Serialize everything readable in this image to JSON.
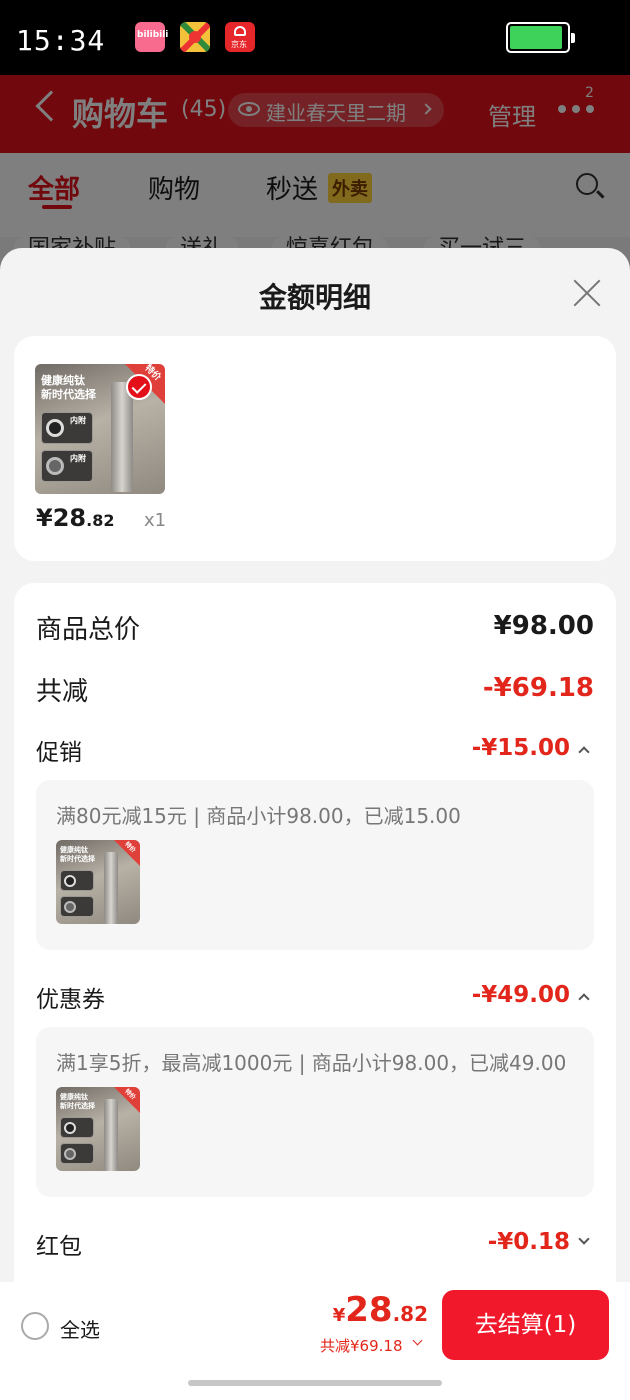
{
  "status_bar": {
    "time": "15:34",
    "app_icons": [
      "bilibili-icon",
      "map-icon",
      "jd-icon"
    ],
    "bili_text": "bilibili",
    "jd_text": "京东"
  },
  "cart_header": {
    "title": "购物车",
    "count": "(45)",
    "address": "建业春天里二期",
    "manage": "管理",
    "badge": "2"
  },
  "tabs": [
    {
      "label": "全部",
      "active": true
    },
    {
      "label": "购物",
      "active": false
    },
    {
      "label": "秒送",
      "active": false
    }
  ],
  "takeout_tag": "外卖",
  "filter_chips": [
    "国家补贴",
    "送礼",
    "惊喜红包",
    "买一试三"
  ],
  "sheet": {
    "title": "金额明细",
    "product": {
      "thumb_text": [
        "健康纯钛",
        "新时代选择"
      ],
      "badge_text": "特价",
      "inner_labels": [
        "内附",
        "内附"
      ],
      "price_int": "¥28",
      "price_dec": ".82",
      "qty": "x1"
    },
    "summary": {
      "total_label": "商品总价",
      "total_value": "¥98.00",
      "discount_label": "共减",
      "discount_value": "-¥69.18"
    },
    "promo": {
      "label": "促销",
      "value": "-¥15.00",
      "detail": "满80元减15元 | 商品小计98.00，已减15.00"
    },
    "coupon": {
      "label": "优惠券",
      "value": "-¥49.00",
      "detail": "满1享5折，最高减1000元 | 商品小计98.00，已减49.00"
    },
    "redpacket": {
      "label": "红包",
      "value": "-¥0.18"
    }
  },
  "bottom_bar": {
    "select_all": "全选",
    "total_yen": "¥",
    "total_int": "28",
    "total_dec": ".82",
    "saved": "共减¥69.18",
    "checkout": "去结算(1)"
  },
  "colors": {
    "brand_red": "#e3101a",
    "price_red": "#e3261b",
    "checkout_red": "#f0182a"
  }
}
